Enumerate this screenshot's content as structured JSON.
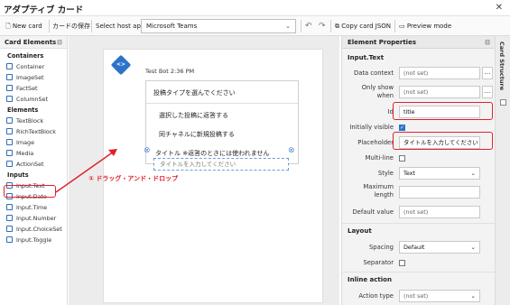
{
  "app": {
    "title": "アダプティブ カード"
  },
  "toolbar": {
    "new_card": "New card",
    "save_card": "カードの保存",
    "host_label": "Select host app:",
    "host_value": "Microsoft Teams",
    "copy_json": "Copy card JSON",
    "preview": "Preview mode"
  },
  "left_panel": {
    "title": "Card Elements",
    "groups": [
      {
        "name": "Containers",
        "items": [
          "Container",
          "ImageSet",
          "FactSet",
          "ColumnSet"
        ]
      },
      {
        "name": "Elements",
        "items": [
          "TextBlock",
          "RichTextBlock",
          "Image",
          "Media",
          "ActionSet"
        ]
      },
      {
        "name": "Inputs",
        "items": [
          "Input.Text",
          "Input.Date",
          "Input.Time",
          "Input.Number",
          "Input.ChoiceSet",
          "Input.Toggle"
        ]
      }
    ],
    "selected_item": "Input.Text"
  },
  "canvas": {
    "bot_time": "Test Bot 2:36 PM",
    "card_lines": [
      "投稿タイプを選んでください",
      "選択した投稿に返答する",
      "同チャネルに新規投稿する",
      "タイトル ※返答のときには使われません"
    ],
    "new_input_placeholder": "タイトルを入力してください",
    "drag_note": "① ドラッグ・アンド・ドロップ"
  },
  "properties": {
    "title": "Element Properties",
    "section": "Input.Text",
    "rows": {
      "data_context": {
        "label": "Data context",
        "value": "(not set)"
      },
      "only_show_when": {
        "label": "Only show when",
        "value": "(not set)"
      },
      "id": {
        "label": "Id",
        "value": "title"
      },
      "initially_visible": {
        "label": "Initially visible",
        "checked": true
      },
      "placeholder": {
        "label": "Placeholder",
        "value": "タイトルを入力してください"
      },
      "multi_line": {
        "label": "Multi-line",
        "checked": false
      },
      "style": {
        "label": "Style",
        "value": "Text"
      },
      "max_length": {
        "label": "Maximum length",
        "value": ""
      },
      "default_value": {
        "label": "Default value",
        "value": "(not set)"
      }
    },
    "layout_section": "Layout",
    "spacing": {
      "label": "Spacing",
      "value": "Default"
    },
    "separator": {
      "label": "Separator",
      "checked": false
    },
    "inline_section": "Inline action",
    "action_type": {
      "label": "Action type",
      "value": "(not set)"
    }
  },
  "structure_tab": {
    "label": "Card Structure"
  },
  "colors": {
    "accent": "#2b74c9",
    "highlight": "#e0202a"
  }
}
